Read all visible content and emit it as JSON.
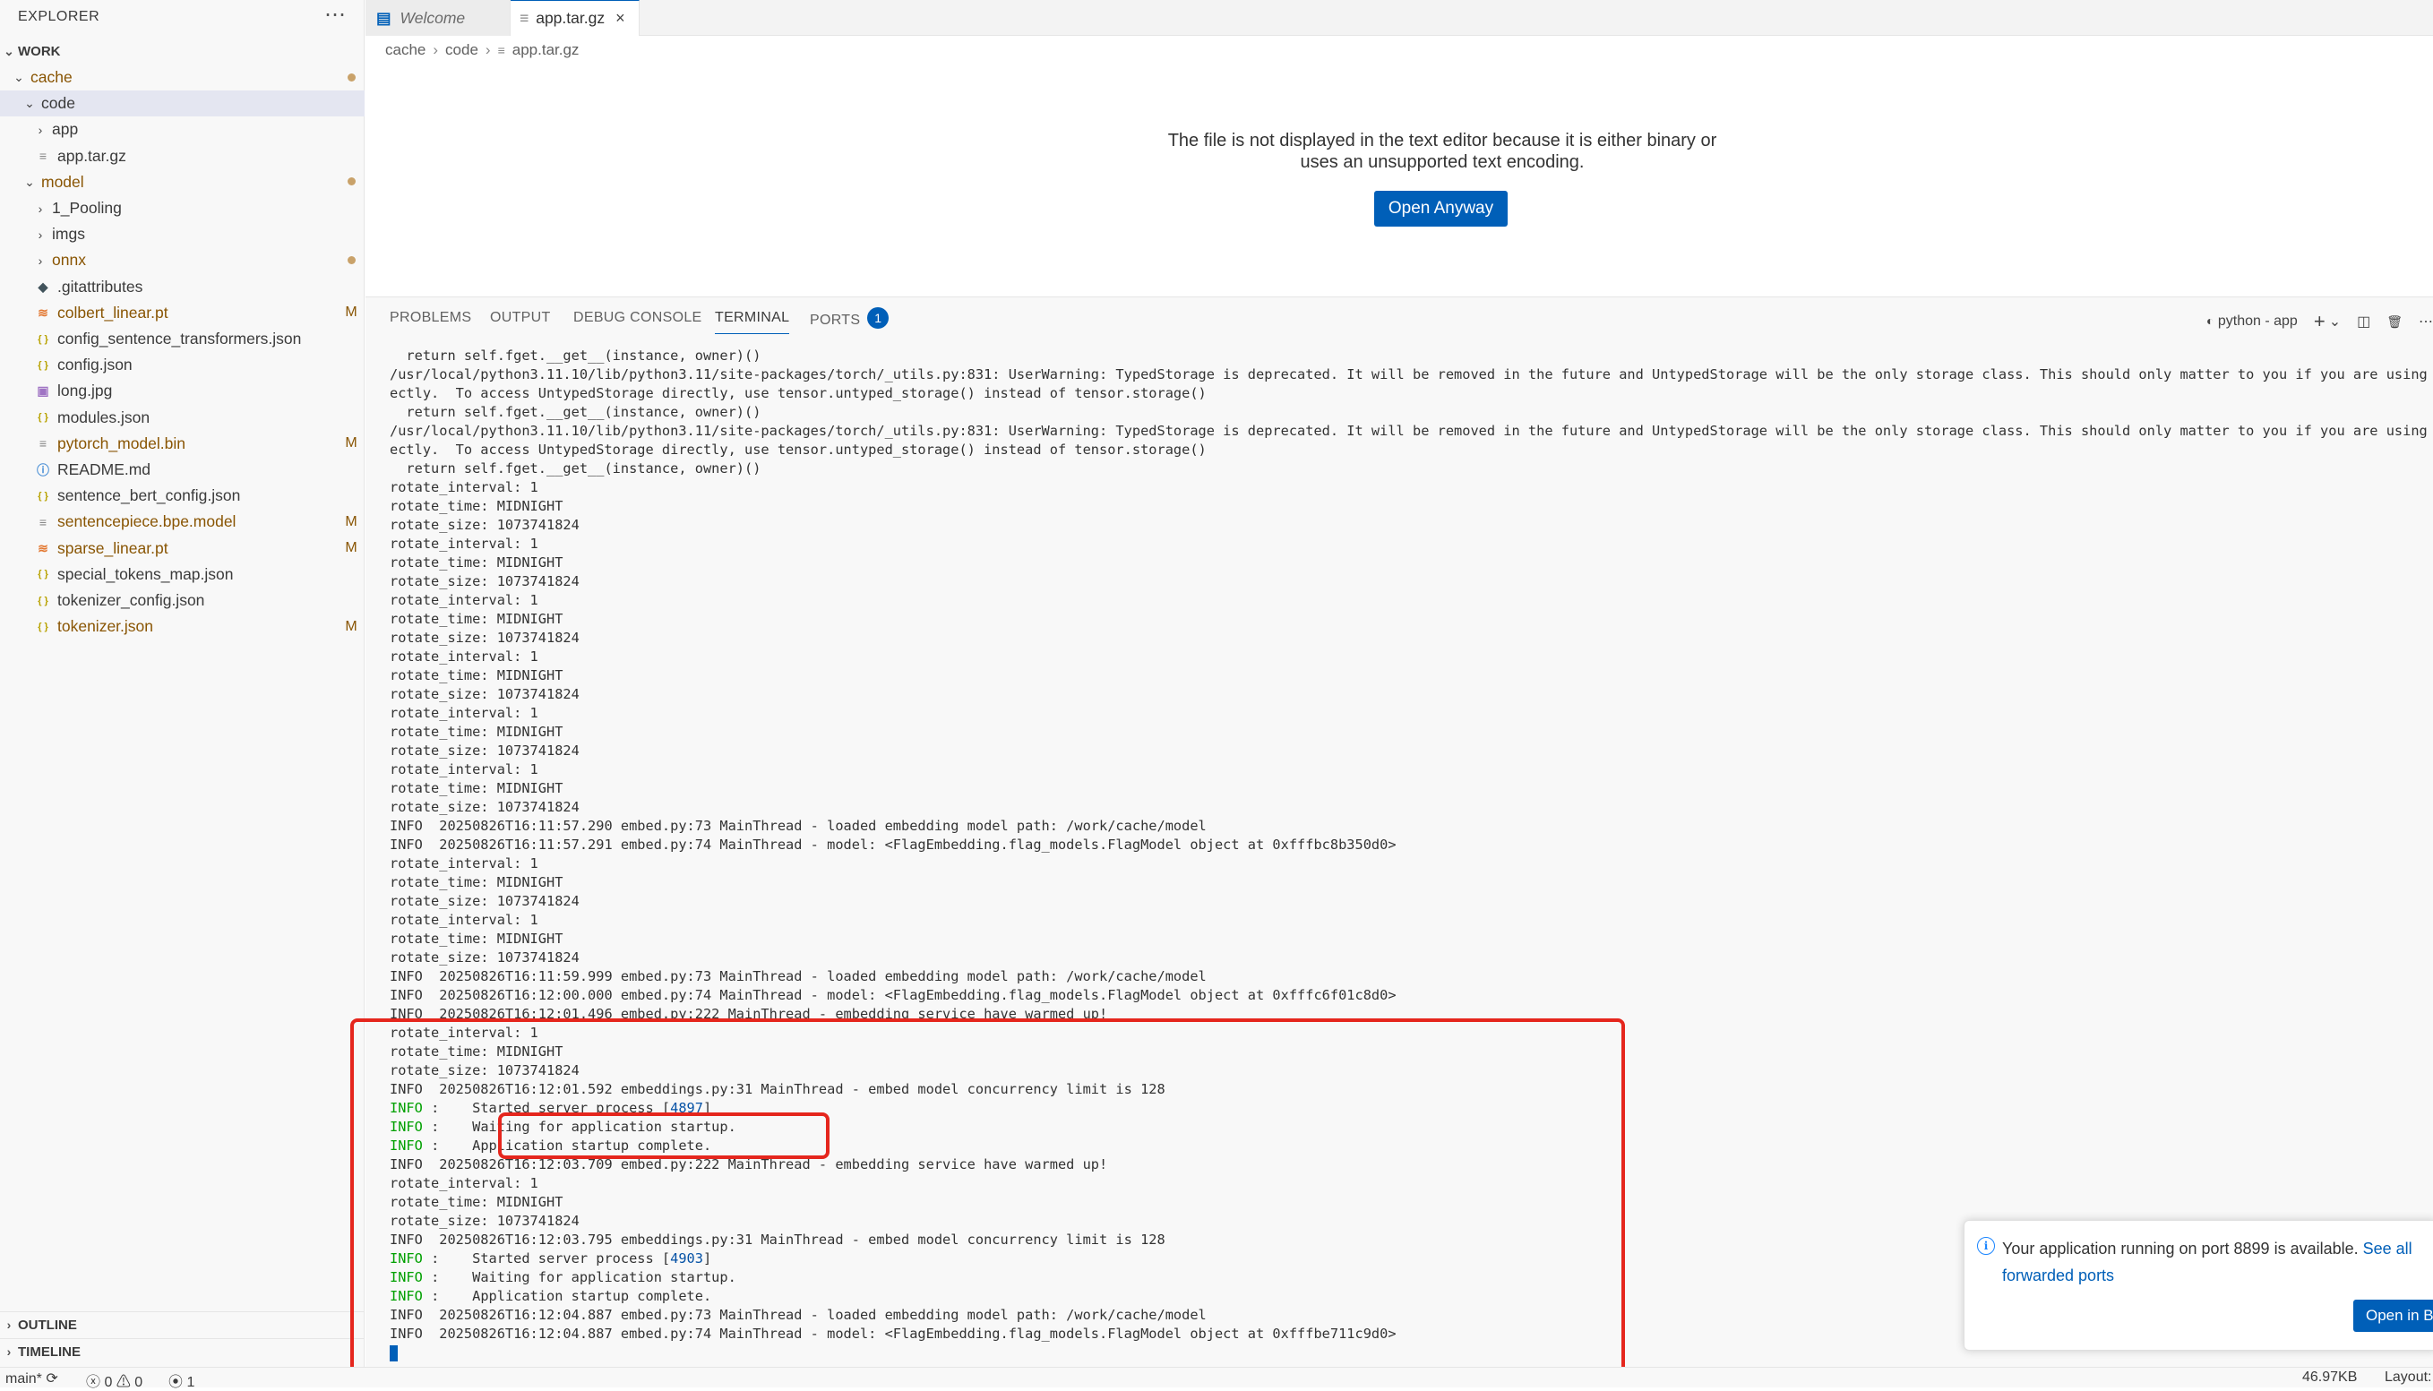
{
  "explorer": {
    "title": "EXPLORER",
    "more_icon": "ellipsis-icon",
    "workspace": "WORK",
    "outline": "OUTLINE",
    "timeline": "TIMELINE",
    "tree": [
      {
        "label": "cache",
        "type": "folder",
        "expanded": true,
        "modified": true,
        "badge": "dot"
      },
      {
        "label": "code",
        "type": "folder",
        "expanded": true,
        "selected": true
      },
      {
        "label": "app",
        "type": "folder",
        "expanded": false
      },
      {
        "label": "app.tar.gz",
        "type": "file",
        "icon": "file-icon"
      },
      {
        "label": "model",
        "type": "folder",
        "expanded": true,
        "modified": true,
        "badge": "dot"
      },
      {
        "label": "1_Pooling",
        "type": "folder",
        "expanded": false
      },
      {
        "label": "imgs",
        "type": "folder",
        "expanded": false
      },
      {
        "label": "onnx",
        "type": "folder",
        "expanded": false,
        "modified": true,
        "badge": "dot"
      },
      {
        "label": ".gitattributes",
        "type": "file",
        "icon": "git-icon"
      },
      {
        "label": "colbert_linear.pt",
        "type": "file",
        "icon": "rss-icon",
        "modified": true,
        "badge": "M"
      },
      {
        "label": "config_sentence_transformers.json",
        "type": "file",
        "icon": "json-icon"
      },
      {
        "label": "config.json",
        "type": "file",
        "icon": "json-icon"
      },
      {
        "label": "long.jpg",
        "type": "file",
        "icon": "image-icon"
      },
      {
        "label": "modules.json",
        "type": "file",
        "icon": "json-icon"
      },
      {
        "label": "pytorch_model.bin",
        "type": "file",
        "icon": "file-icon",
        "modified": true,
        "badge": "M"
      },
      {
        "label": "README.md",
        "type": "file",
        "icon": "info-icon"
      },
      {
        "label": "sentence_bert_config.json",
        "type": "file",
        "icon": "json-icon"
      },
      {
        "label": "sentencepiece.bpe.model",
        "type": "file",
        "icon": "file-icon",
        "modified": true,
        "badge": "M"
      },
      {
        "label": "sparse_linear.pt",
        "type": "file",
        "icon": "rss-icon",
        "modified": true,
        "badge": "M"
      },
      {
        "label": "special_tokens_map.json",
        "type": "file",
        "icon": "json-icon"
      },
      {
        "label": "tokenizer_config.json",
        "type": "file",
        "icon": "json-icon"
      },
      {
        "label": "tokenizer.json",
        "type": "file",
        "icon": "json-icon",
        "modified": true,
        "badge": "M"
      }
    ]
  },
  "tabs": [
    {
      "label": "Welcome",
      "icon": "welcome-icon",
      "active": false
    },
    {
      "label": "app.tar.gz",
      "icon": "file-icon",
      "active": true,
      "close": "×"
    }
  ],
  "breadcrumb": {
    "parts": [
      "cache",
      "code",
      "app.tar.gz"
    ],
    "sep": "›"
  },
  "editor": {
    "message_line1": "The file is not displayed in the text editor because it is either binary or",
    "message_line2": "uses an unsupported text encoding.",
    "open_anyway": "Open Anyway"
  },
  "panel": {
    "tabs": [
      "PROBLEMS",
      "OUTPUT",
      "DEBUG CONSOLE",
      "TERMINAL",
      "PORTS"
    ],
    "active_tab": "TERMINAL",
    "ports_count": "1",
    "terminal_name": "python - app",
    "actions": {
      "add": "+",
      "dropdown": "⌄",
      "split": "◫",
      "trash": "🗑",
      "more": "⋯"
    }
  },
  "terminal_lines": [
    {
      "text": "  return self.fget.__get__(instance, owner)()"
    },
    {
      "text": "/usr/local/python3.11.10/lib/python3.11/site-packages/torch/_utils.py:831: UserWarning: TypedStorage is deprecated. It will be removed in the future and UntypedStorage will be the only storage class. This should only matter to you if you are using storages dir"
    },
    {
      "text": "ectly.  To access UntypedStorage directly, use tensor.untyped_storage() instead of tensor.storage()"
    },
    {
      "text": "  return self.fget.__get__(instance, owner)()"
    },
    {
      "text": "/usr/local/python3.11.10/lib/python3.11/site-packages/torch/_utils.py:831: UserWarning: TypedStorage is deprecated. It will be removed in the future and UntypedStorage will be the only storage class. This should only matter to you if you are using storages dir"
    },
    {
      "text": "ectly.  To access UntypedStorage directly, use tensor.untyped_storage() instead of tensor.storage()"
    },
    {
      "text": "  return self.fget.__get__(instance, owner)()"
    },
    {
      "text": "rotate_interval: 1"
    },
    {
      "text": "rotate_time: MIDNIGHT"
    },
    {
      "text": "rotate_size: 1073741824"
    },
    {
      "text": "rotate_interval: 1"
    },
    {
      "text": "rotate_time: MIDNIGHT"
    },
    {
      "text": "rotate_size: 1073741824"
    },
    {
      "text": "rotate_interval: 1"
    },
    {
      "text": "rotate_time: MIDNIGHT"
    },
    {
      "text": "rotate_size: 1073741824"
    },
    {
      "text": "rotate_interval: 1"
    },
    {
      "text": "rotate_time: MIDNIGHT"
    },
    {
      "text": "rotate_size: 1073741824"
    },
    {
      "text": "rotate_interval: 1"
    },
    {
      "text": "rotate_time: MIDNIGHT"
    },
    {
      "text": "rotate_size: 1073741824"
    },
    {
      "text": "rotate_interval: 1"
    },
    {
      "text": "rotate_time: MIDNIGHT"
    },
    {
      "text": "rotate_size: 1073741824"
    },
    {
      "text": "INFO  20250826T16:11:57.290 embed.py:73 MainThread - loaded embedding model path: /work/cache/model"
    },
    {
      "text": "INFO  20250826T16:11:57.291 embed.py:74 MainThread - model: <FlagEmbedding.flag_models.FlagModel object at 0xfffbc8b350d0>"
    },
    {
      "text": "rotate_interval: 1"
    },
    {
      "text": "rotate_time: MIDNIGHT"
    },
    {
      "text": "rotate_size: 1073741824"
    },
    {
      "text": "rotate_interval: 1"
    },
    {
      "text": "rotate_time: MIDNIGHT"
    },
    {
      "text": "rotate_size: 1073741824"
    },
    {
      "text": "INFO  20250826T16:11:59.999 embed.py:73 MainThread - loaded embedding model path: /work/cache/model"
    },
    {
      "text": "INFO  20250826T16:12:00.000 embed.py:74 MainThread - model: <FlagEmbedding.flag_models.FlagModel object at 0xfffc6f01c8d0>"
    },
    {
      "text": "INFO  20250826T16:12:01.496 embed.py:222 MainThread - embedding service have warmed up!"
    },
    {
      "text": "rotate_interval: 1"
    },
    {
      "text": "rotate_time: MIDNIGHT"
    },
    {
      "text": "rotate_size: 1073741824"
    },
    {
      "text": "INFO  20250826T16:12:01.592 embeddings.py:31 MainThread - embed model concurrency limit is 128"
    },
    {
      "prefix": "INFO",
      "text": ":    Started server process [",
      "pid": "4897",
      "suffix": "]"
    },
    {
      "prefix": "INFO",
      "text": ":    Waiting for application startup."
    },
    {
      "prefix": "INFO",
      "text": ":    Application startup complete."
    },
    {
      "text": "INFO  20250826T16:12:03.709 embed.py:222 MainThread - embedding service have warmed up!"
    },
    {
      "text": "rotate_interval: 1"
    },
    {
      "text": "rotate_time: MIDNIGHT"
    },
    {
      "text": "rotate_size: 1073741824"
    },
    {
      "text": "INFO  20250826T16:12:03.795 embeddings.py:31 MainThread - embed model concurrency limit is 128"
    },
    {
      "prefix": "INFO",
      "text": ":    Started server process [",
      "pid": "4903",
      "suffix": "]"
    },
    {
      "prefix": "INFO",
      "text": ":    Waiting for application startup."
    },
    {
      "prefix": "INFO",
      "text": ":    Application startup complete."
    },
    {
      "text": "INFO  20250826T16:12:04.887 embed.py:73 MainThread - loaded embedding model path: /work/cache/model"
    },
    {
      "text": "INFO  20250826T16:12:04.887 embed.py:74 MainThread - model: <FlagEmbedding.flag_models.FlagModel object at 0xfffbe711c9d0>"
    }
  ],
  "notification": {
    "text": "Your application running on port 8899 is available.",
    "link": "See all forwarded ports",
    "button": "Open in B"
  },
  "statusbar": {
    "branch": "main*",
    "errors": "0",
    "warnings": "0",
    "ports": "1",
    "size": "46.97KB",
    "layout": "Layout:"
  },
  "colors": {
    "accent": "#005fb8",
    "modified": "#895503",
    "annotation": "#e5261d",
    "info_green": "#00a000"
  }
}
